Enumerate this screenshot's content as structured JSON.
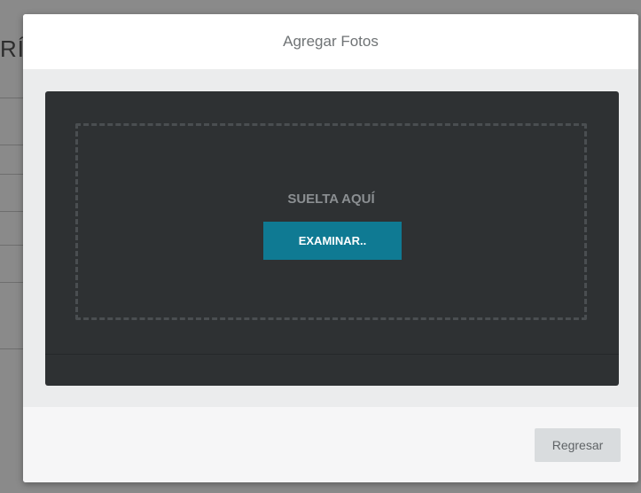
{
  "background": {
    "title_fragment": "RÍ"
  },
  "modal": {
    "title": "Agregar Fotos",
    "dropzone": {
      "drop_text": "SUELTA AQUÍ",
      "browse_label": "EXAMINAR.."
    },
    "footer": {
      "back_label": "Regresar"
    }
  },
  "colors": {
    "accent": "#0f7a93",
    "panel": "#2e3133"
  }
}
